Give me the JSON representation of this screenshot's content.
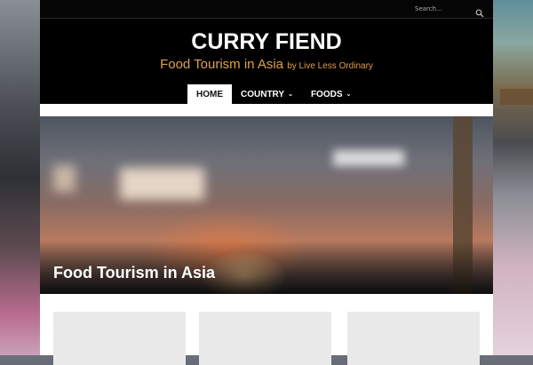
{
  "search": {
    "placeholder": "Search..."
  },
  "site": {
    "title": "CURRY FIEND",
    "tagline_main": "Food Tourism in Asia",
    "tagline_by": "by Live Less Ordinary"
  },
  "nav": {
    "items": [
      {
        "label": "HOME",
        "active": true
      },
      {
        "label": "COUNTRY",
        "dropdown": true
      },
      {
        "label": "FOODS",
        "dropdown": true
      }
    ]
  },
  "hero": {
    "title": "Food Tourism in Asia"
  },
  "icons": {
    "search": "search-icon",
    "chevron": "chevron-down-icon"
  },
  "colors": {
    "header_bg": "#000000",
    "tagline": "#e0a04a",
    "nav_active_bg": "#ffffff"
  }
}
